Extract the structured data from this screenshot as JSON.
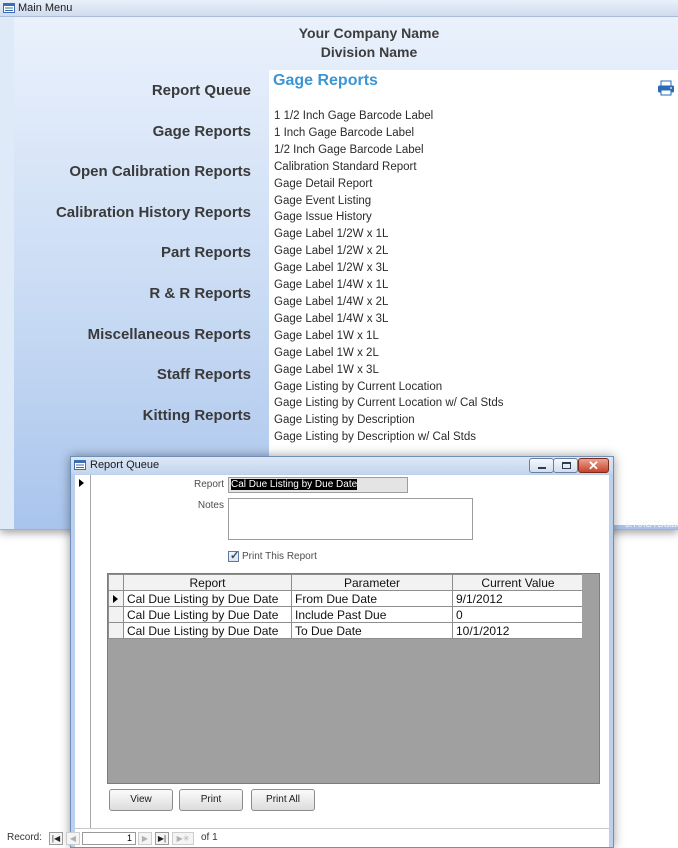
{
  "main_window": {
    "title": "Main Menu",
    "company_name": "Your Company Name",
    "division_name": "Division Name",
    "nav_items": [
      {
        "label": "Report Queue"
      },
      {
        "label": "Gage Reports"
      },
      {
        "label": "Open Calibration Reports"
      },
      {
        "label": "Calibration History Reports"
      },
      {
        "label": "Part Reports"
      },
      {
        "label": "R & R Reports"
      },
      {
        "label": "Miscellaneous Reports"
      },
      {
        "label": "Staff Reports"
      },
      {
        "label": "Kitting Reports"
      }
    ],
    "panel_title": "Gage Reports",
    "reports": [
      "1 1/2 Inch Gage Barcode Label",
      "1 Inch Gage Barcode Label",
      "1/2 Inch Gage Barcode Label",
      "Calibration Standard Report",
      "Gage Detail Report",
      "Gage Event Listing",
      "Gage Issue History",
      "Gage Label 1/2W x 1L",
      "Gage Label 1/2W x 2L",
      "Gage Label 1/2W x 3L",
      "Gage Label 1/4W x 1L",
      "Gage Label 1/4W x 2L",
      "Gage Label 1/4W x 3L",
      "Gage Label 1W x 1L",
      "Gage Label 1W x 2L",
      "Gage Label 1W x 3L",
      "Gage Listing by Current Location",
      "Gage Listing by Current Location w/ Cal Stds",
      "Gage Listing by Description",
      "Gage Listing by Description w/ Cal Stds"
    ],
    "path_text": "6.70\\GTData6"
  },
  "report_queue": {
    "title": "Report Queue",
    "report_label": "Report",
    "report_value": "Cal Due Listing by Due Date",
    "notes_label": "Notes",
    "notes_value": "",
    "print_checkbox_label": "Print This Report",
    "print_checked": true,
    "columns": [
      "Report",
      "Parameter",
      "Current Value"
    ],
    "rows": [
      {
        "report": "Cal Due Listing by Due Date",
        "parameter": "From Due Date",
        "value": "9/1/2012"
      },
      {
        "report": "Cal Due Listing by Due Date",
        "parameter": "Include Past Due",
        "value": "0"
      },
      {
        "report": "Cal Due Listing by Due Date",
        "parameter": "To Due Date",
        "value": "10/1/2012"
      }
    ],
    "buttons": {
      "view": "View",
      "print": "Print",
      "print_all": "Print All"
    },
    "navigation": {
      "record_label": "Record:",
      "current": "1",
      "total_text": "of 1"
    }
  },
  "colors": {
    "panel_title": "#3d95d6",
    "close_button": "#c8432b"
  },
  "icons": [
    "form-icon",
    "printer-icon",
    "minimize-icon",
    "maximize-icon",
    "close-icon",
    "check-icon",
    "row-selector-icon",
    "first-record-icon",
    "previous-record-icon",
    "next-record-icon",
    "last-record-icon",
    "new-record-icon"
  ]
}
